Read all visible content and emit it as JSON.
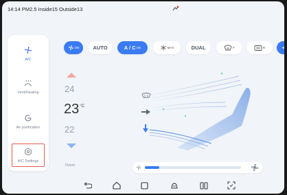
{
  "status": {
    "text": "14:14 PM2.5 Inside15 Outside13"
  },
  "sidebar": {
    "items": [
      {
        "label": "A/C",
        "icon": "fan-icon"
      },
      {
        "label": "Vent/Heating",
        "icon": "vent-heating-icon"
      },
      {
        "label": "Air purification",
        "icon": "air-purification-icon"
      },
      {
        "label": "A/C Settings",
        "icon": "settings-icon"
      }
    ]
  },
  "controls": {
    "on": {
      "label": "ON"
    },
    "auto": {
      "label": "AUTO"
    },
    "ac": {
      "label": "A / C",
      "sub": "ON"
    },
    "max": {
      "label": "MAX"
    },
    "dual": {
      "label": "DUAL"
    },
    "front": {
      "label": "F"
    },
    "rear": {
      "label": "R"
    }
  },
  "temperature": {
    "above": "24",
    "current": "23",
    "unit": "°C",
    "below": "22",
    "zone": "Driver"
  },
  "fan": {
    "level": 0.15
  },
  "colors": {
    "accent": "#3b7bf2",
    "selection_border": "#e25a4a",
    "up_arrow": "#f2a8a0",
    "down_arrow": "#8fb6f2"
  },
  "nav": {
    "icons": [
      "back-icon",
      "home-icon",
      "recents-icon",
      "car-icon",
      "split-screen-icon",
      "screenshot-icon"
    ]
  }
}
